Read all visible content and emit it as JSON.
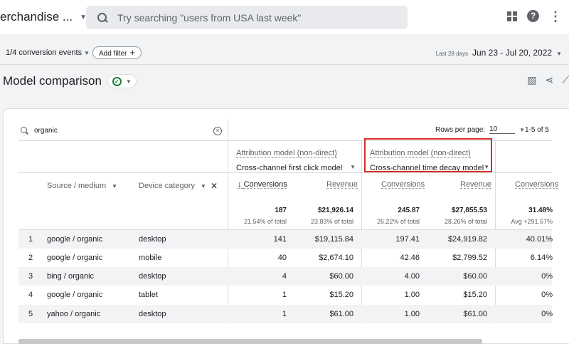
{
  "topbar": {
    "property_name": "erchandise ...",
    "search_placeholder": "Try searching \"users from USA last week\""
  },
  "filterbar": {
    "conversion_events": "1/4 conversion events",
    "add_filter": "Add filter",
    "date_label": "Last 28 days",
    "date_value": "Jun 23 - Jul 20, 2022"
  },
  "page": {
    "title": "Model comparison"
  },
  "table": {
    "search_query": "organic",
    "rows_per_page_label": "Rows per page:",
    "rows_per_page_value": "10",
    "pager_text": "1-5 of 5",
    "models": [
      {
        "label": "Attribution model (non-direct)",
        "value": "Cross-channel first click model"
      },
      {
        "label": "Attribution model (non-direct)",
        "value": "Cross-channel time decay model"
      }
    ],
    "dim_headers": {
      "source": "Source / medium",
      "device": "Device category"
    },
    "metric_headers": [
      "Conversions",
      "Revenue",
      "Conversions",
      "Revenue",
      "Conversions"
    ],
    "totals": [
      {
        "main": "187",
        "sub": "21.54% of total"
      },
      {
        "main": "$21,926.14",
        "sub": "23.83% of total"
      },
      {
        "main": "245.87",
        "sub": "26.22% of total"
      },
      {
        "main": "$27,855.53",
        "sub": "28.26% of total"
      },
      {
        "main": "31.48%",
        "sub": "Avg +291.57%"
      }
    ],
    "rows": [
      {
        "idx": "1",
        "source": "google / organic",
        "device": "desktop",
        "c1": "141",
        "r1": "$19,115.84",
        "c2": "197.41",
        "r2": "$24,919.82",
        "pct": "40.01%"
      },
      {
        "idx": "2",
        "source": "google / organic",
        "device": "mobile",
        "c1": "40",
        "r1": "$2,674.10",
        "c2": "42.46",
        "r2": "$2,799.52",
        "pct": "6.14%"
      },
      {
        "idx": "3",
        "source": "bing / organic",
        "device": "desktop",
        "c1": "4",
        "r1": "$60.00",
        "c2": "4.00",
        "r2": "$60.00",
        "pct": "0%"
      },
      {
        "idx": "4",
        "source": "google / organic",
        "device": "tablet",
        "c1": "1",
        "r1": "$15.20",
        "c2": "1.00",
        "r2": "$15.20",
        "pct": "0%"
      },
      {
        "idx": "5",
        "source": "yahoo / organic",
        "device": "desktop",
        "c1": "1",
        "r1": "$61.00",
        "c2": "1.00",
        "r2": "$61.00",
        "pct": "0%"
      }
    ]
  },
  "colors": {
    "accent_red": "#d93025",
    "check_green": "#188038"
  }
}
